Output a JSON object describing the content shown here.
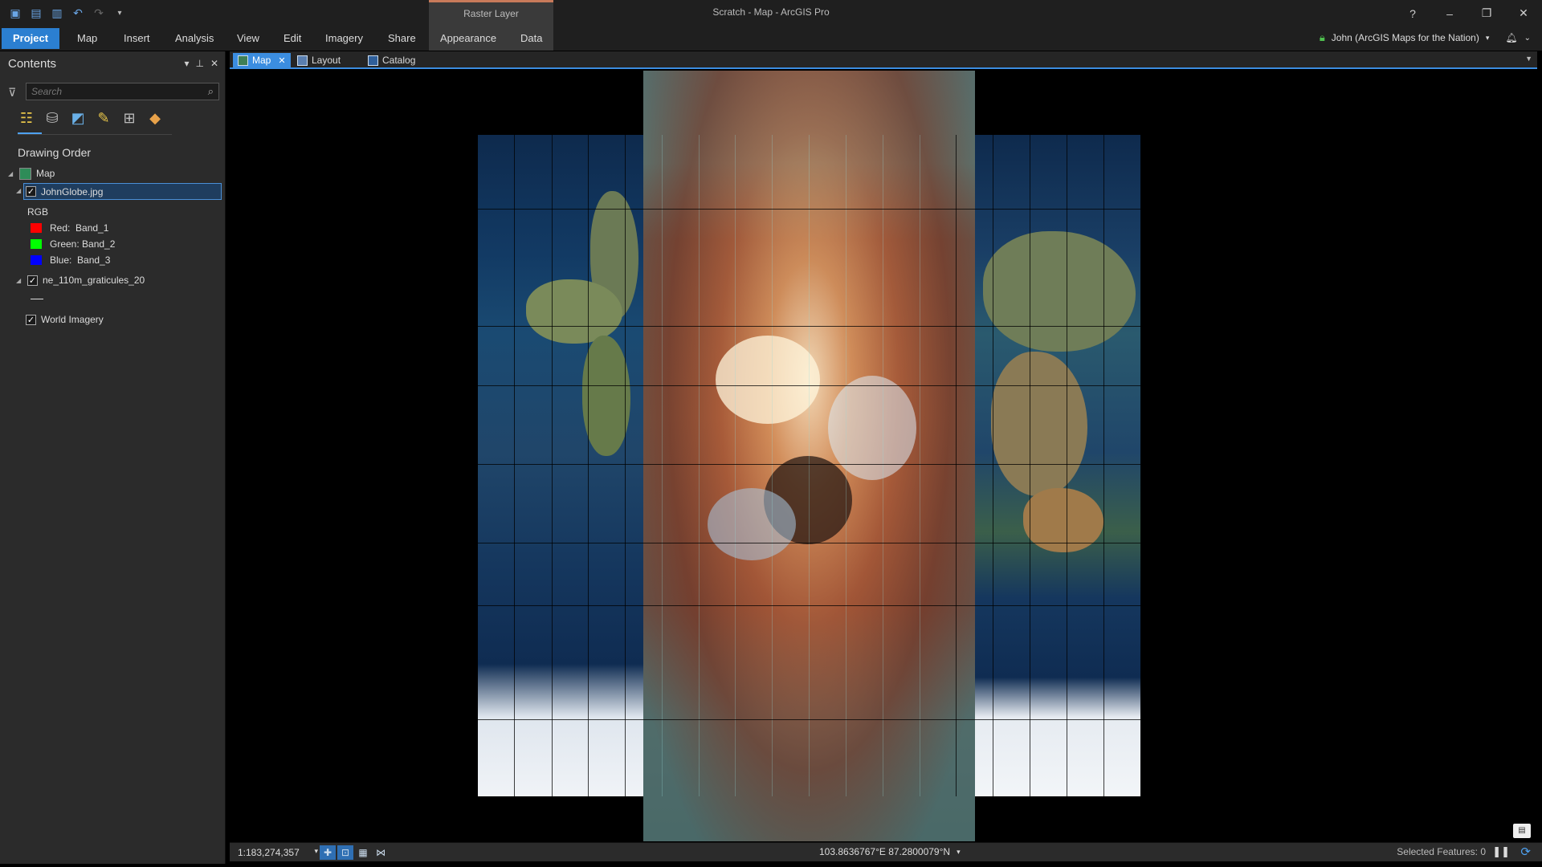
{
  "titlebar": {
    "app_title": "Scratch - Map - ArcGIS Pro",
    "contextual_header": "Raster Layer",
    "help": "?",
    "minimize": "–",
    "restore": "❐",
    "close": "✕"
  },
  "ribbon": {
    "tabs": [
      "Project",
      "Map",
      "Insert",
      "Analysis",
      "View",
      "Edit",
      "Imagery",
      "Share",
      "Appearance",
      "Data"
    ],
    "active_tab": "Project",
    "user": "John (ArcGIS Maps for the Nation)"
  },
  "contents": {
    "title": "Contents",
    "search_placeholder": "Search",
    "drawing_order_label": "Drawing Order",
    "map_label": "Map",
    "layers": [
      {
        "name": "JohnGlobe.jpg",
        "checked": true,
        "selected": true
      },
      {
        "name": "ne_110m_graticules_20",
        "checked": true,
        "selected": false
      },
      {
        "name": "World Imagery",
        "checked": true,
        "selected": false
      }
    ],
    "rgb_label": "RGB",
    "bands": [
      {
        "label": "Red:",
        "band": "Band_1",
        "color": "#ff0000"
      },
      {
        "label": "Green:",
        "band": "Band_2",
        "color": "#00ff00"
      },
      {
        "label": "Blue:",
        "band": "Band_3",
        "color": "#0000ff"
      }
    ]
  },
  "view_tabs": [
    {
      "label": "Map",
      "active": true
    },
    {
      "label": "Layout",
      "active": false
    },
    {
      "label": "Catalog",
      "active": false
    }
  ],
  "status": {
    "scale": "1:183,274,357",
    "coordinates": "103.8636767°E 87.2800079°N",
    "selected_features": "Selected Features: 0"
  },
  "colors": {
    "accent": "#2b7fd1",
    "contextual": "#c87a5a",
    "panel_bg": "#2b2b2b"
  },
  "icons": {
    "new": "new-project-icon",
    "open": "open-project-icon",
    "save": "save-icon",
    "undo": "undo-icon",
    "redo": "redo-icon",
    "filter": "filter-icon",
    "search": "search-icon",
    "notification": "bell-icon"
  }
}
